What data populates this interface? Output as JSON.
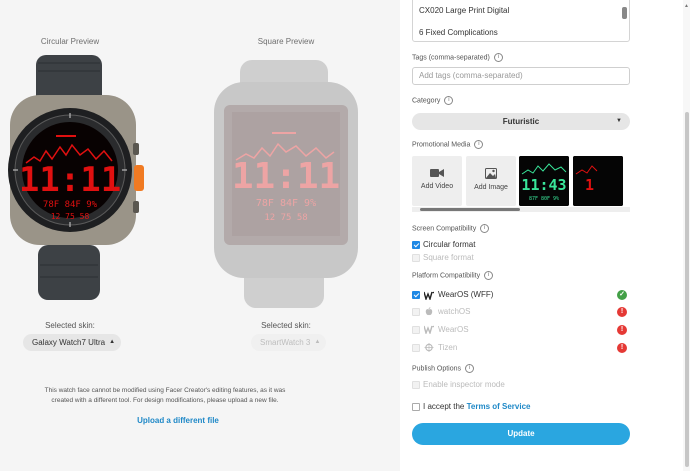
{
  "preview": {
    "circular_title": "Circular Preview",
    "square_title": "Square Preview",
    "selected_skin_label": "Selected skin:",
    "circular_skin": "Galaxy Watch7 Ultra",
    "square_skin": "SmartWatch 3",
    "watch_time": "11:11",
    "notice": "This watch face cannot be modified using Facer Creator's editing features, as it was created with a different tool. For design modifications, please upload a new file.",
    "upload_link": "Upload a different file"
  },
  "form": {
    "description_lines": [
      "CX020 Large Print Digital",
      "6 Fixed Complications"
    ],
    "tags_label": "Tags (comma-separated)",
    "tags_placeholder": "Add tags (comma-separated)",
    "category_label": "Category",
    "category_value": "Futuristic",
    "promo_label": "Promotional Media",
    "add_video": "Add Video",
    "add_image": "Add Image",
    "thumb_time": "11:43",
    "screen_compat_label": "Screen Compatibility",
    "screen_options": [
      {
        "label": "Circular format",
        "checked": true,
        "disabled": false
      },
      {
        "label": "Square format",
        "checked": false,
        "disabled": true
      }
    ],
    "platform_label": "Platform Compatibility",
    "platforms": [
      {
        "label": "WearOS (WFF)",
        "icon": "wearos-icon",
        "checked": true,
        "status": "ok"
      },
      {
        "label": "watchOS",
        "icon": "apple-icon",
        "checked": false,
        "status": "error"
      },
      {
        "label": "WearOS",
        "icon": "wearos-icon",
        "checked": false,
        "status": "error"
      },
      {
        "label": "Tizen",
        "icon": "tizen-icon",
        "checked": false,
        "status": "error"
      }
    ],
    "publish_label": "Publish Options",
    "inspector_label": "Enable inspector mode",
    "accept_prefix": "I accept the",
    "terms_link": "Terms of Service",
    "update_button": "Update"
  },
  "colors": {
    "accent": "#2aa6e0",
    "link": "#1e88c7",
    "watch_red": "#e01010",
    "thumb_green": "#39e69a",
    "status_ok": "#43a047",
    "status_error": "#e53935"
  }
}
